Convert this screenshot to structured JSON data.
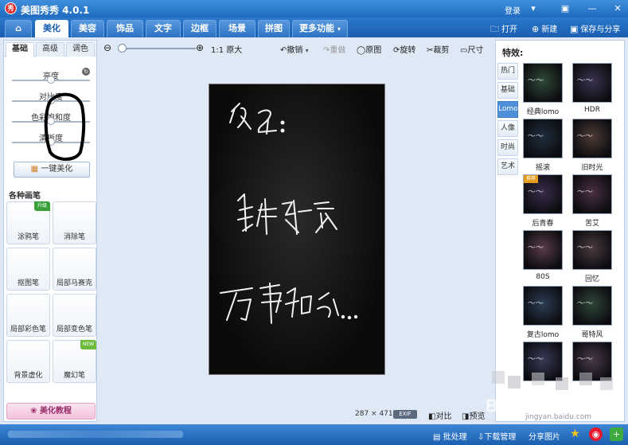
{
  "app": {
    "logo_text": "秀",
    "title": "美图秀秀 4.0.1",
    "login": "登录"
  },
  "window_controls": [
    {
      "name": "menu-icon",
      "glyph": "▾"
    },
    {
      "name": "skin-icon",
      "glyph": "▣"
    },
    {
      "name": "minimize-icon",
      "glyph": "—"
    },
    {
      "name": "close-icon",
      "glyph": "✕"
    }
  ],
  "menu": {
    "home_icon": "⌂",
    "tabs": [
      "美化",
      "美容",
      "饰品",
      "文字",
      "边框",
      "场景",
      "拼图",
      "更多功能"
    ],
    "more_arrow": "▾",
    "active": "美化"
  },
  "top_actions": {
    "open": {
      "icon": "folder-icon",
      "glyph": "🗀",
      "label": "打开"
    },
    "new": {
      "icon": "plus-circle-icon",
      "glyph": "⊕",
      "label": "新建"
    },
    "save": {
      "icon": "save-icon",
      "glyph": "💾",
      "label": "保存与分享"
    }
  },
  "left_panel": {
    "subtabs": [
      "基础",
      "高级",
      "调色"
    ],
    "active_subtab": "基础",
    "reset_glyph": "↻",
    "sliders": [
      {
        "label": "亮度",
        "value_pct": 50
      },
      {
        "label": "对比度",
        "value_pct": 50
      },
      {
        "label": "色彩饱和度",
        "value_pct": 50
      },
      {
        "label": "清晰度",
        "value_pct": 50
      }
    ],
    "one_click": "一键美化",
    "brush_section": "各种画笔",
    "brushes": [
      {
        "label": "涂鸦笔",
        "badge": "升级",
        "color": "#f0a429"
      },
      {
        "label": "消除笔",
        "badge": "",
        "color": "#e26a6a"
      },
      {
        "label": "抠图笔",
        "badge": "",
        "color": "#3a78c8"
      },
      {
        "label": "局部马赛克",
        "badge": "",
        "color": "#4aa0e8"
      },
      {
        "label": "局部彩色笔",
        "badge": "",
        "color": "#e0a020"
      },
      {
        "label": "局部变色笔",
        "badge": "",
        "color": "#6cbb3c"
      },
      {
        "label": "背景虚化",
        "badge": "",
        "color": "#58a848"
      },
      {
        "label": "魔幻笔",
        "badge": "NEW",
        "color": "#3a8ad8"
      }
    ],
    "tutorial": "美化教程"
  },
  "toolbar": {
    "zoom_out": "⊖",
    "zoom_in": "⊕",
    "zoom_pct": 0,
    "original_size": "1:1 原大",
    "undo": "撤销",
    "undo_arrow": "▾",
    "redo": "重做",
    "original": "原图",
    "rotate": "旋转",
    "crop": "裁剪",
    "resize": "尺寸"
  },
  "canvas": {
    "handwriting": [
      "名字:",
      "身体健康",
      "万事如意..."
    ]
  },
  "status": {
    "size": "287 × 471",
    "exif": "EXIF",
    "compare": "对比",
    "preview": "预览"
  },
  "right_panel": {
    "title": "特效:",
    "categories": [
      "热门",
      "基础",
      "Lomo",
      "人像",
      "时尚",
      "艺术"
    ],
    "active_category": "Lomo",
    "effects": [
      {
        "label": "经典lomo",
        "tone": "#2e4a38"
      },
      {
        "label": "HDR",
        "tone": "#3b3350"
      },
      {
        "label": "摇滚",
        "tone": "#1f2e3e"
      },
      {
        "label": "旧时光",
        "tone": "#4e3a34"
      },
      {
        "label": "后青春",
        "tone": "#3a2c4c",
        "badge": "推荐"
      },
      {
        "label": "苦艾",
        "tone": "#4b2f44"
      },
      {
        "label": "80S",
        "tone": "#5a3c4a"
      },
      {
        "label": "回忆",
        "tone": "#4a3a40"
      },
      {
        "label": "复古lomo",
        "tone": "#2b3e55"
      },
      {
        "label": "哥特风",
        "tone": "#2e4638"
      },
      {
        "label": "",
        "tone": "#3a3a5a"
      },
      {
        "label": "",
        "tone": "#4a3a4a"
      }
    ]
  },
  "bottom_bar": {
    "batch": "批处理",
    "download": "下载管理",
    "share": "分享图片"
  },
  "watermark": {
    "text": "Bai 经验",
    "url": "jingyan.baidu.com"
  }
}
